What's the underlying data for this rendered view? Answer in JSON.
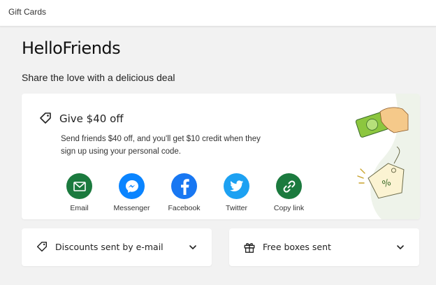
{
  "header": {
    "breadcrumb": "Gift Cards"
  },
  "page": {
    "title": "HelloFriends",
    "subtitle": "Share the love with a delicious deal"
  },
  "offer": {
    "title": "Give $40 off",
    "description": "Send friends $40 off, and you'll get $10 credit when they sign up using your personal code."
  },
  "share": [
    {
      "label": "Email",
      "icon": "envelope-icon",
      "color": "#1b7a3e"
    },
    {
      "label": "Messenger",
      "icon": "messenger-icon",
      "color": "#0a84ff"
    },
    {
      "label": "Facebook",
      "icon": "facebook-icon",
      "color": "#1877f2"
    },
    {
      "label": "Twitter",
      "icon": "twitter-icon",
      "color": "#1da1f2"
    },
    {
      "label": "Copy link",
      "icon": "link-icon",
      "color": "#1b7a3e"
    }
  ],
  "sections": {
    "discounts": {
      "label": "Discounts sent by e-mail"
    },
    "boxes": {
      "label": "Free boxes sent"
    }
  }
}
